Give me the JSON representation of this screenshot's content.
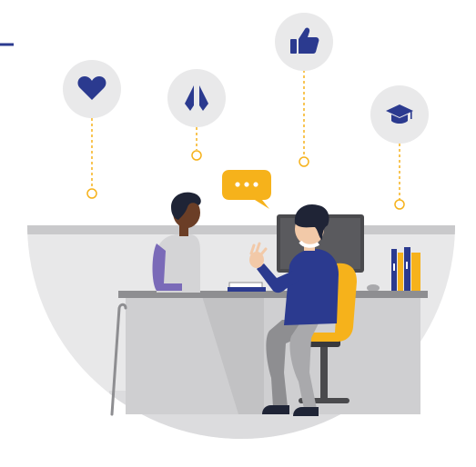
{
  "colors": {
    "accent_blue": "#2b3a8f",
    "accent_yellow": "#f6b21b",
    "icon_bubble": "#e9e9ea",
    "floor": "#e8e8e9",
    "wall_band": "#c9c9cb",
    "desk": "#cfcfd1",
    "desk_top": "#8e8e91",
    "skin_dark": "#6b3e26",
    "skin_light": "#f2c9a8",
    "hair_dark": "#1f2436",
    "shirt_gray": "#d4d4d6",
    "sleeve_purple": "#7a6ab8"
  },
  "icons": [
    {
      "name": "heart-icon"
    },
    {
      "name": "praying-hands-icon"
    },
    {
      "name": "thumbs-up-icon"
    },
    {
      "name": "graduation-cap-icon"
    }
  ],
  "speech_bubble": {
    "icon": "ellipsis-icon"
  }
}
